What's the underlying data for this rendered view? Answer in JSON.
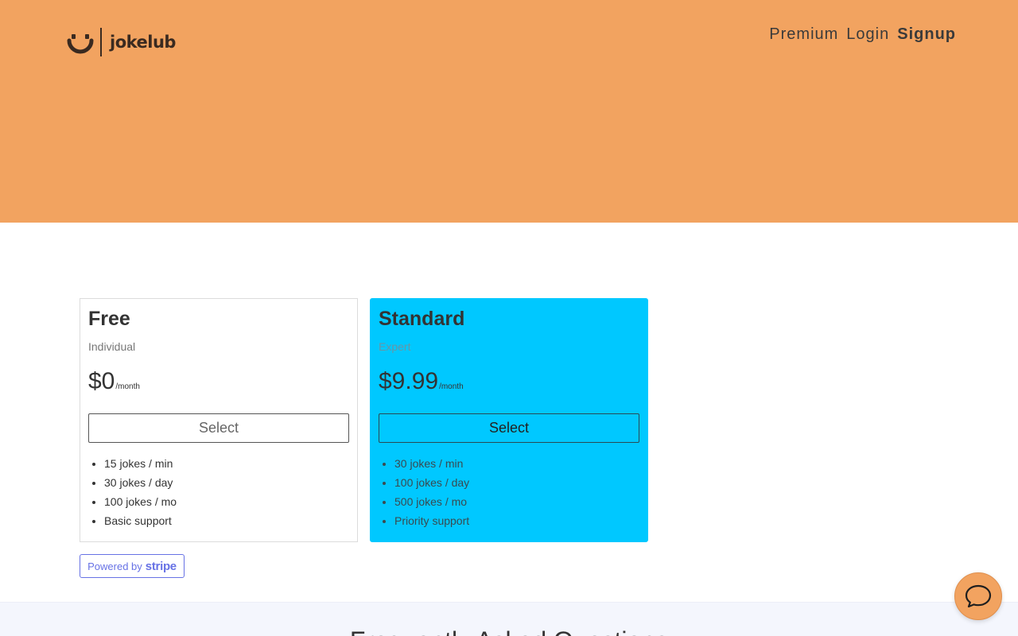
{
  "header": {
    "brand": "jokelub",
    "nav": [
      {
        "label": "Premium"
      },
      {
        "label": "Login"
      },
      {
        "label": "Signup"
      }
    ],
    "background_color": "#f2a360",
    "logo_icon": "smile-icon"
  },
  "plans": [
    {
      "title": "Free",
      "subtitle": "Individual",
      "price": "$0",
      "period": "/month",
      "button_label": "Select",
      "features": [
        "15 jokes / min",
        "30 jokes / day",
        "100 jokes / mo",
        "Basic support"
      ],
      "background_color": "#ffffff"
    },
    {
      "title": "Standard",
      "subtitle": "Expert",
      "price": "$9.99",
      "period": "/month",
      "button_label": "Select",
      "features": [
        "30 jokes / min",
        "100 jokes / day",
        "500 jokes / mo",
        "Priority support"
      ],
      "background_color": "#00c8ff"
    }
  ],
  "stripe_badge": {
    "powered_by": "Powered by",
    "brand": "stripe",
    "color": "#6772e5"
  },
  "faq": {
    "heading": "Frequently Asked Questions"
  },
  "chat": {
    "icon": "chat-bubble-icon",
    "color": "#f2a360"
  }
}
